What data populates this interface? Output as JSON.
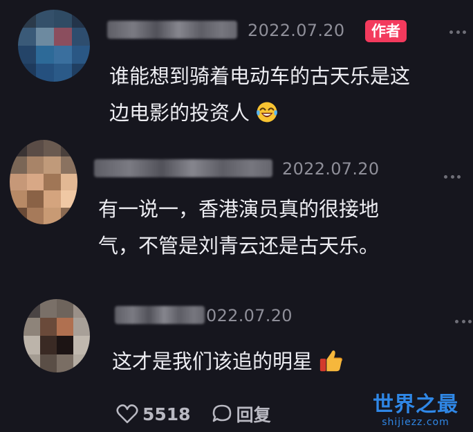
{
  "comments": [
    {
      "timestamp": "2022.07.20",
      "badge": "作者",
      "lines": [
        "谁能想到骑着电动车的古天乐是这",
        "边电影的投资人"
      ],
      "emoji": "laughing-tears-emoji"
    },
    {
      "timestamp": "2022.07.20",
      "lines": [
        "有一说一，香港演员真的很接地",
        "气，不管是刘青云还是古天乐。"
      ]
    },
    {
      "timestamp": "022.07.20",
      "lines": [
        "这才是我们该追的明星"
      ],
      "emoji": "thumbs-up-emoji"
    }
  ],
  "actions": {
    "like_count": "5518",
    "reply_label": "回复",
    "like_icon": "heart-icon",
    "reply_icon": "speech-bubble-icon"
  },
  "watermark": {
    "title": "世界之最",
    "url": "shijiezz.com"
  },
  "colors": {
    "background": "#16161e",
    "badge": "#f33a5d",
    "timestamp": "#8f8f99",
    "text": "#ededf2",
    "watermark": "#2f87e6"
  }
}
